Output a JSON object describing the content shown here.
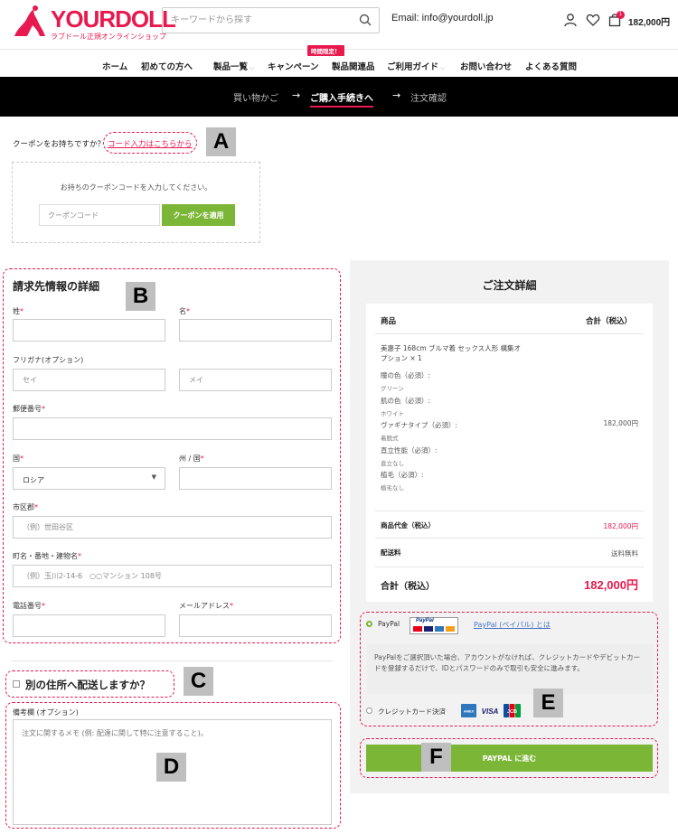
{
  "header": {
    "logo_text": "YOURDOLL",
    "logo_sub": "ラブドール正規オンラインショップ",
    "search_placeholder": "キーワードから探す",
    "email": "Email: info@yourdoll.jp",
    "cart_count": "1",
    "cart_total": "182,000円"
  },
  "nav": {
    "items": [
      "ホーム",
      "初めての方へ",
      "製品一覧",
      "キャンペーン",
      "製品関連品",
      "ご利用ガイド",
      "お問い合わせ",
      "よくある質問"
    ],
    "badge": "時間限定！"
  },
  "steps": [
    "買い物かご",
    "ご購入手続きへ",
    "注文確認"
  ],
  "coupon": {
    "question": "クーポンをお持ちですか？",
    "link": "コード入力はこちらから",
    "hint": "お持ちのクーポンコードを入力してください。",
    "placeholder": "クーポンコード",
    "button": "クーポンを適用"
  },
  "markers": [
    "A",
    "B",
    "C",
    "D",
    "E",
    "F"
  ],
  "billing": {
    "title": "請求先情報の詳細",
    "last_name": "姓",
    "first_name": "名",
    "furigana": "フリガナ(オプション)",
    "furigana_sei": "セイ",
    "furigana_mei": "メイ",
    "postcode": "郵便番号",
    "country": "国",
    "country_value": "ロシア",
    "state": "州 / 国",
    "city": "市区郡",
    "city_placeholder": "（例）世田谷区",
    "address": "町名・番地・建物名",
    "address_placeholder": "（例）玉川2-14-6　○○マンション 108号",
    "phone": "電話番号",
    "mail": "メールアドレス",
    "required_mark": "*"
  },
  "shipping": {
    "label": "別の住所へ配送しますか？"
  },
  "notes": {
    "label": "備考欄 (オプション)",
    "placeholder": "注文に関するメモ (例: 配達に関して特に注意すること)。"
  },
  "order": {
    "title": "ご注文詳細",
    "col_product": "商品",
    "col_total": "合計（税込）",
    "product_name": "美惠子 168cm ブルマ着 セックス人形 構集オプション × 1",
    "options": [
      {
        "label": "瞳の色（必須）:",
        "value": "グリーン"
      },
      {
        "label": "肌の色（必須）:",
        "value": "ホワイト"
      },
      {
        "label": "ヴァギナタイプ（必須）:",
        "value": "着脱式"
      },
      {
        "label": "直立性能（必須）:",
        "value": "直立なし"
      },
      {
        "label": "植毛（必須）:",
        "value": "植毛なし"
      }
    ],
    "product_price": "182,000円",
    "subtotal_label": "商品代金（税込）",
    "subtotal_value": "182,000円",
    "shipping_label": "配送料",
    "shipping_value": "送料無料",
    "total_label": "合計（税込）",
    "total_value": "182,000円"
  },
  "payment": {
    "paypal_label": "PayPal",
    "paypal_logo": "PayPal",
    "paypal_link": "PayPal (ペイパル) とは",
    "paypal_desc": "PayPalをご選択頂いた場合、アカウントがなければ、クレジットカードやデビットカードを登録するだけで、IDとパスワードのみで取引も安全に進みます。",
    "card_label": "クレジットカード決済",
    "card_brands": [
      "AMEX",
      "VISA",
      "JCB"
    ],
    "place_order": "PAYPAL に進む"
  },
  "colors": {
    "brand": "#e8194f",
    "accent_green": "#7cb637",
    "steps_bg": "#000000"
  }
}
